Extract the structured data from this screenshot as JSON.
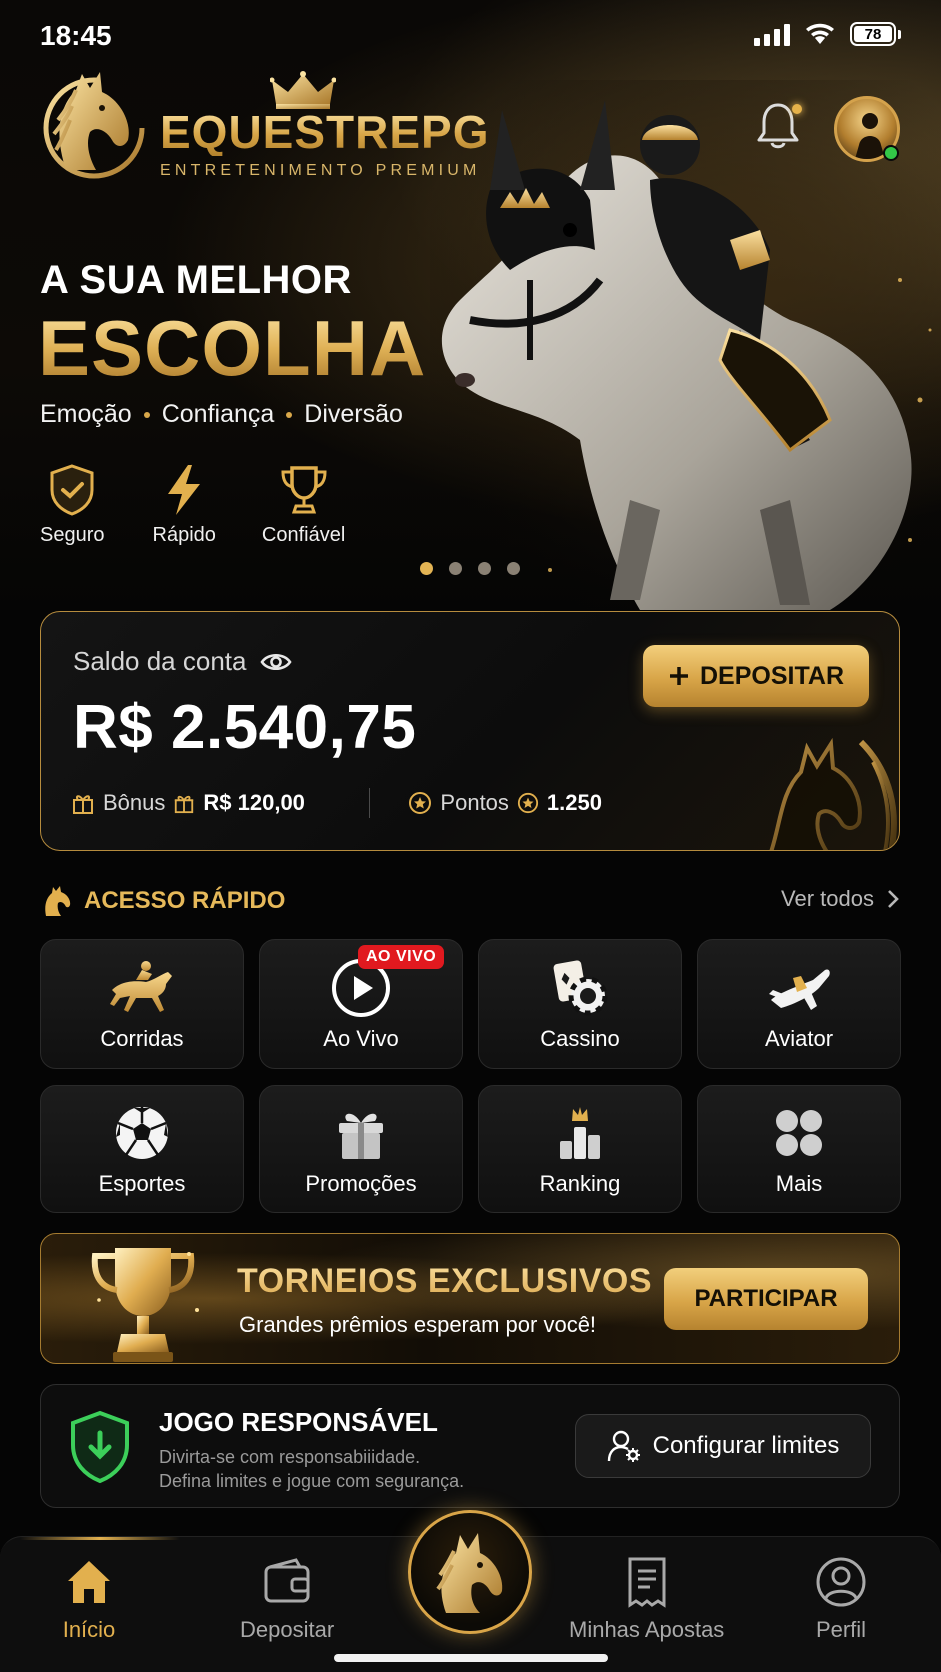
{
  "status_bar": {
    "time": "18:45",
    "battery": "78"
  },
  "brand": {
    "name": "EQUESTREPG",
    "tagline": "ENTRETENIMENTO PREMIUM"
  },
  "hero": {
    "kicker": "A SUA MELHOR",
    "title": "ESCOLHA",
    "subtitle": [
      "Emoção",
      "Confiança",
      "Diversão"
    ],
    "features": [
      {
        "icon": "shield-check-icon",
        "label": "Seguro"
      },
      {
        "icon": "lightning-icon",
        "label": "Rápido"
      },
      {
        "icon": "trophy-icon",
        "label": "Confiável"
      }
    ],
    "carousel": {
      "slides": 4,
      "active": 0
    }
  },
  "balance": {
    "label": "Saldo da conta",
    "amount": "R$ 2.540,75",
    "deposit_label": "DEPOSITAR",
    "bonus_label": "Bônus",
    "bonus_value": "R$ 120,00",
    "points_label": "Pontos",
    "points_value": "1.250"
  },
  "quick_access": {
    "title": "ACESSO RÁPIDO",
    "see_all": "Ver todos",
    "live_badge": "AO VIVO",
    "items": [
      {
        "label": "Corridas",
        "icon": "horse-racing-icon"
      },
      {
        "label": "Ao Vivo",
        "icon": "play-icon"
      },
      {
        "label": "Cassino",
        "icon": "casino-icon"
      },
      {
        "label": "Aviator",
        "icon": "airplane-icon"
      },
      {
        "label": "Esportes",
        "icon": "soccer-ball-icon"
      },
      {
        "label": "Promoções",
        "icon": "gift-icon"
      },
      {
        "label": "Ranking",
        "icon": "ranking-icon"
      },
      {
        "label": "Mais",
        "icon": "grid-icon"
      }
    ]
  },
  "tournament": {
    "title": "TORNEIOS EXCLUSIVOS",
    "subtitle": "Grandes prêmios esperam por você!",
    "button": "PARTICIPAR"
  },
  "responsible": {
    "title": "JOGO RESPONSÁVEL",
    "line1": "Divirta-se com responsabiiidade.",
    "line2": "Defina limites e jogue com segurança.",
    "button": "Configurar limites"
  },
  "bottom_nav": {
    "items": [
      {
        "label": "Início",
        "icon": "home-icon",
        "active": true
      },
      {
        "label": "Depositar",
        "icon": "wallet-icon",
        "active": false
      },
      {
        "label": "Minhas Apostas",
        "icon": "receipt-icon",
        "active": false
      },
      {
        "label": "Perfil",
        "icon": "user-icon",
        "active": false
      }
    ]
  },
  "colors": {
    "gold": "#e2b04e",
    "background": "#050505",
    "live_red": "#e1191f",
    "online_green": "#33c748",
    "shield_green": "#3ccf5a"
  }
}
